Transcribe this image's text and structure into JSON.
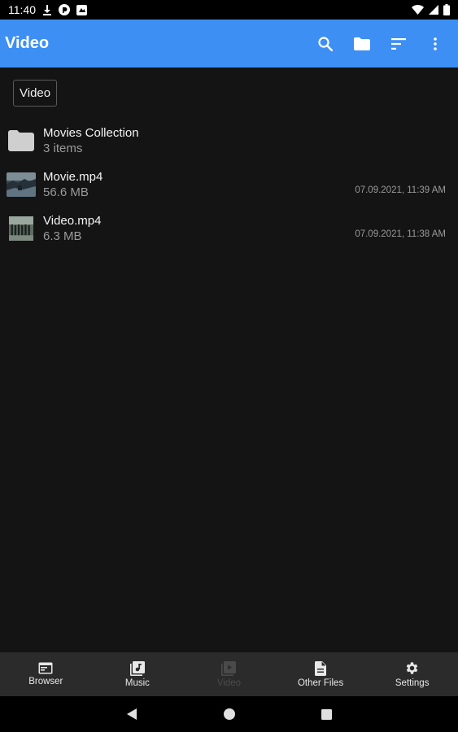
{
  "status_bar": {
    "time": "11:40",
    "icons": [
      "download-icon",
      "pocket-casts-icon",
      "notification-icon",
      "wifi-icon",
      "signal-icon",
      "battery-icon"
    ]
  },
  "app_bar": {
    "title": "Video",
    "actions": [
      "search-icon",
      "folder-icon",
      "sort-icon",
      "more-vert-icon"
    ],
    "color": "#3d8ff4"
  },
  "breadcrumb": {
    "label": "Video"
  },
  "files": [
    {
      "name": "Movies Collection",
      "sub": "3 items",
      "date": "",
      "type": "folder"
    },
    {
      "name": "Movie.mp4",
      "sub": "56.6 MB",
      "date": "07.09.2021, 11:39 AM",
      "type": "video"
    },
    {
      "name": "Video.mp4",
      "sub": "6.3 MB",
      "date": "07.09.2021, 11:38 AM",
      "type": "video"
    }
  ],
  "bottom_nav": [
    {
      "label": "Browser",
      "icon": "browser-icon",
      "active": false
    },
    {
      "label": "Music",
      "icon": "music-library-icon",
      "active": false
    },
    {
      "label": "Video",
      "icon": "video-library-icon",
      "active": true
    },
    {
      "label": "Other Files",
      "icon": "file-icon",
      "active": false
    },
    {
      "label": "Settings",
      "icon": "gear-icon",
      "active": false
    }
  ],
  "system_nav": [
    "back-icon",
    "home-icon",
    "recents-icon"
  ]
}
